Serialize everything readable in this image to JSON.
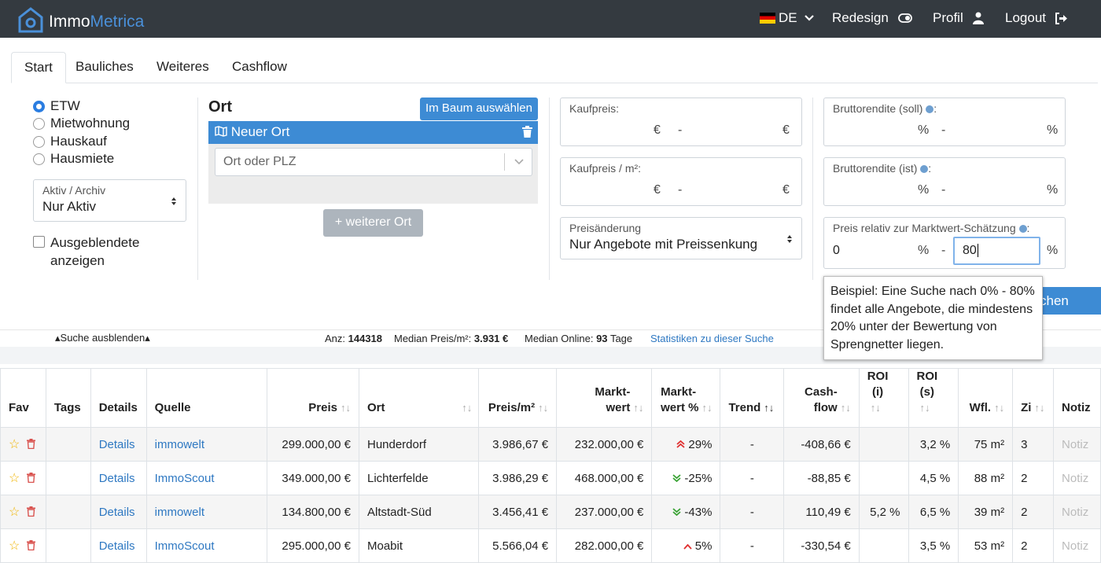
{
  "header": {
    "logo_part1": "Immo",
    "logo_part2": "Metrica",
    "lang": "DE",
    "redesign": "Redesign",
    "profil": "Profil",
    "logout": "Logout"
  },
  "tabs": [
    "Start",
    "Bauliches",
    "Weiteres",
    "Cashflow"
  ],
  "types": [
    "ETW",
    "Mietwohnung",
    "Hauskauf",
    "Hausmiete"
  ],
  "status": {
    "label": "Aktiv / Archiv",
    "value": "Nur Aktiv"
  },
  "hidden_checkbox": "Ausgeblendete anzeigen",
  "ort": {
    "title": "Ort",
    "tree_button": "Im Baum auswählen",
    "new_label": "Neuer Ort",
    "placeholder": "Ort oder PLZ",
    "add_button": "weiterer Ort"
  },
  "kaufpreis": {
    "label": "Kaufpreis:",
    "unit": "€",
    "sep": "-"
  },
  "kaufpreis_qm": {
    "label": "Kaufpreis / m²:",
    "unit": "€",
    "sep": "-"
  },
  "preisaenderung": {
    "label": "Preisänderung",
    "value": "Nur Angebote mit Preissenkung"
  },
  "bruttorendite_soll": {
    "label": "Bruttorendite (soll)",
    "suffix": ":",
    "unit": "%",
    "sep": "-"
  },
  "bruttorendite_ist": {
    "label": "Bruttorendite (ist)",
    "suffix": ":",
    "unit": "%",
    "sep": "-"
  },
  "preis_relativ": {
    "label": "Preis relativ zur Marktwert-Schätzung",
    "suffix": ":",
    "from": "0",
    "to": "80",
    "unit": "%",
    "sep": "-"
  },
  "search_button_partial": "chen",
  "tooltip": "Beispiel: Eine Suche nach 0% - 80% findet alle Angebote, die mindestens 20% unter der Bewertung von Sprengnetter liegen.",
  "stats": {
    "hide_search": "Suche ausblenden",
    "anz_label": "Anz:",
    "anz": "144318",
    "median_qm_label": "Median Preis/m²:",
    "median_qm": "3.931 €",
    "median_online_label": "Median Online:",
    "median_online": "93",
    "median_online_unit": "Tage",
    "stats_link": "Statistiken zu dieser Suche"
  },
  "table": {
    "columns": [
      "Fav",
      "Tags",
      "Details",
      "Quelle",
      "Preis",
      "Ort",
      "Preis/m²",
      "Markt-\nwert",
      "Markt-\nwert %",
      "Trend",
      "Cash-\nflow",
      "ROI\n(i)",
      "ROI\n(s)",
      "Wfl.",
      "Zi",
      "Notiz"
    ],
    "rows": [
      {
        "details": "Details",
        "quelle": "immowelt",
        "preis": "299.000,00 €",
        "ort": "Hunderdorf",
        "preis_qm": "3.986,67 €",
        "marktwert": "232.000,00 €",
        "marktwert_pct": "29%",
        "trend_dir": "up2",
        "trend": "-",
        "cashflow": "-408,66 €",
        "roi_i": "",
        "roi_s": "3,2 %",
        "wfl": "75 m²",
        "zi": "3",
        "notiz": "Notiz"
      },
      {
        "details": "Details",
        "quelle": "ImmoScout",
        "preis": "349.000,00 €",
        "ort": "Lichterfelde",
        "preis_qm": "3.986,29 €",
        "marktwert": "468.000,00 €",
        "marktwert_pct": "-25%",
        "trend_dir": "down2",
        "trend": "-",
        "cashflow": "-88,85 €",
        "roi_i": "",
        "roi_s": "4,5 %",
        "wfl": "88 m²",
        "zi": "2",
        "notiz": "Notiz"
      },
      {
        "details": "Details",
        "quelle": "immowelt",
        "preis": "134.800,00 €",
        "ort": "Altstadt-Süd",
        "preis_qm": "3.456,41 €",
        "marktwert": "237.000,00 €",
        "marktwert_pct": "-43%",
        "trend_dir": "down2",
        "trend": "-",
        "cashflow": "110,49 €",
        "roi_i": "5,2 %",
        "roi_s": "6,5 %",
        "wfl": "39 m²",
        "zi": "2",
        "notiz": "Notiz"
      },
      {
        "details": "Details",
        "quelle": "ImmoScout",
        "preis": "295.000,00 €",
        "ort": "Moabit",
        "preis_qm": "5.566,04 €",
        "marktwert": "282.000,00 €",
        "marktwert_pct": "5%",
        "trend_dir": "up1",
        "trend": "-",
        "cashflow": "-330,54 €",
        "roi_i": "",
        "roi_s": "3,5 %",
        "wfl": "53 m²",
        "zi": "2",
        "notiz": "Notiz"
      }
    ]
  },
  "colors": {
    "topbar": "#343a40",
    "accent": "#3d8bd4",
    "link": "#2e78c2",
    "up": "#e03030",
    "down": "#3aa335",
    "delete": "#d9534f",
    "star": "#f0b400"
  }
}
